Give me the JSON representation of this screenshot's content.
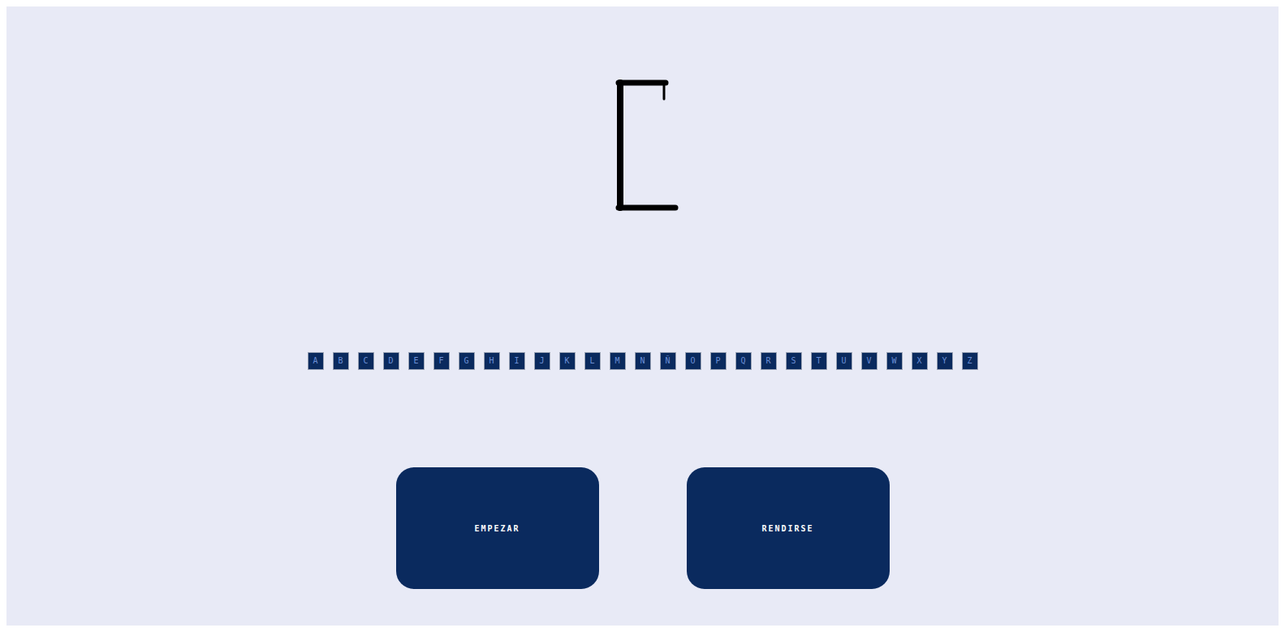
{
  "hangman": {
    "errors": 0
  },
  "letters": [
    {
      "label": "A"
    },
    {
      "label": "B"
    },
    {
      "label": "C"
    },
    {
      "label": "D"
    },
    {
      "label": "E"
    },
    {
      "label": "F"
    },
    {
      "label": "G"
    },
    {
      "label": "H"
    },
    {
      "label": "I"
    },
    {
      "label": "J"
    },
    {
      "label": "K"
    },
    {
      "label": "L"
    },
    {
      "label": "M"
    },
    {
      "label": "N"
    },
    {
      "label": "Ñ"
    },
    {
      "label": "O"
    },
    {
      "label": "P"
    },
    {
      "label": "Q"
    },
    {
      "label": "R"
    },
    {
      "label": "S"
    },
    {
      "label": "T"
    },
    {
      "label": "U"
    },
    {
      "label": "V"
    },
    {
      "label": "W"
    },
    {
      "label": "X"
    },
    {
      "label": "Y"
    },
    {
      "label": "Z"
    }
  ],
  "buttons": [
    {
      "label": "EMPEZAR"
    },
    {
      "label": "RENDIRSE"
    }
  ]
}
